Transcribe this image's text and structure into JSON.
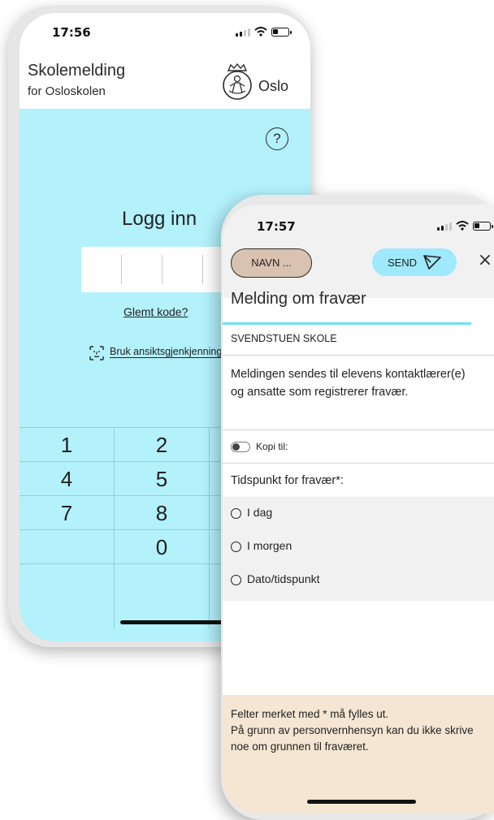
{
  "login_phone": {
    "status": {
      "time": "17:56"
    },
    "header": {
      "title": "Skolemelding",
      "subtitle": "for Osloskolen",
      "brand": "Oslo"
    },
    "help_icon": "?",
    "login": {
      "title": "Logg inn",
      "forgot_link": "Glemt kode?",
      "faceid_label": "Bruk ansiktsgjenkjenning"
    },
    "keypad": {
      "row1": [
        "1",
        "2",
        ""
      ],
      "row2": [
        "4",
        "5",
        ""
      ],
      "row3": [
        "7",
        "8",
        ""
      ],
      "row4": [
        "",
        "0",
        ""
      ]
    },
    "colors": {
      "background": "#b3f1fb",
      "header": "#ffffff"
    }
  },
  "message_phone": {
    "status": {
      "time": "17:57"
    },
    "toolbar": {
      "name_button": "NAVN ...",
      "send_button": "SEND",
      "close_icon": "×"
    },
    "form": {
      "title": "Melding om fravær",
      "school": "SVENDSTUEN SKOLE",
      "info": "Meldingen sendes til elevens kontaktlærer(e) og ansatte som registrerer fravær.",
      "copy_label": "Kopi til:",
      "time_label": "Tidspunkt for fravær*:",
      "options": [
        "I dag",
        "I morgen",
        "Dato/tidspunkt"
      ]
    },
    "footer": {
      "line1": "Felter merket med * må fylles ut.",
      "line2": "På grunn av personvernhensyn kan du ikke skrive noe om grunnen til fraværet."
    },
    "colors": {
      "accent": "#6ee0f6",
      "send_button": "#9ee9fb",
      "name_button": "#d9c2b0",
      "footer": "#f4e6d3"
    }
  }
}
